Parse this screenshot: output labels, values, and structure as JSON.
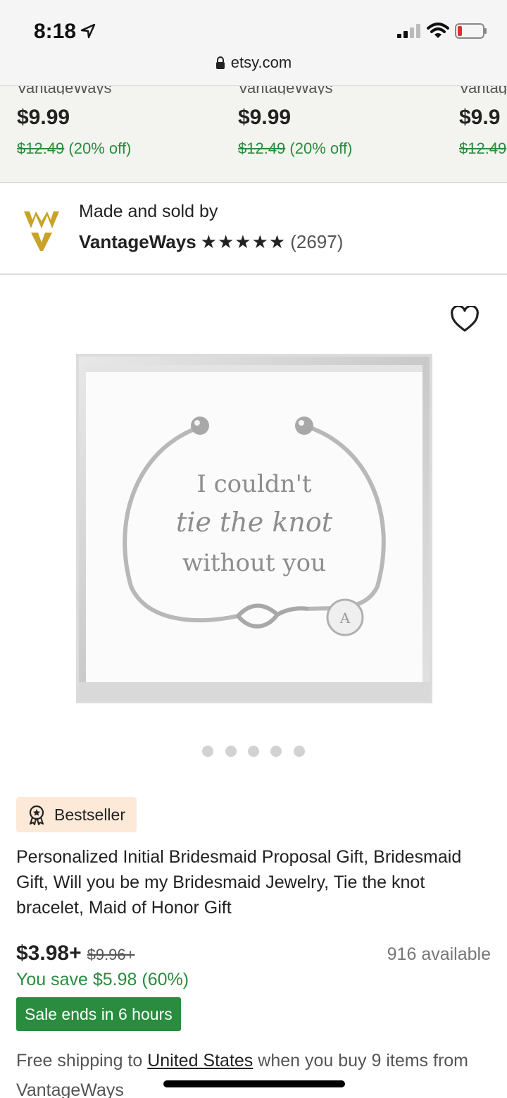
{
  "status_bar": {
    "time": "8:18"
  },
  "browser": {
    "url": "etsy.com"
  },
  "related_items": [
    {
      "shop": "VantageWays",
      "price": "$9.99",
      "original_price": "$12.49",
      "discount": "(20% off)"
    },
    {
      "shop": "VantageWays",
      "price": "$9.99",
      "original_price": "$12.49",
      "discount": "(20% off)"
    },
    {
      "shop": "Vantag",
      "price": "$9.9",
      "original_price": "$12.49",
      "discount": ""
    }
  ],
  "seller": {
    "made_by_label": "Made and sold by",
    "name": "VantageWays",
    "stars": "★★★★★",
    "review_count": "(2697)",
    "logo_letters": "WV"
  },
  "gallery": {
    "image_text_line1": "I couldn't",
    "image_text_line2": "tie the knot",
    "image_text_line3": "without you",
    "charm_letter": "A",
    "image_count": 5,
    "active_index": 0
  },
  "listing": {
    "badge": "Bestseller",
    "title": "Personalized Initial Bridesmaid Proposal Gift, Bridesmaid Gift, Will you be my Bridesmaid Jewelry, Tie the knot bracelet, Maid of Honor Gift",
    "price": "$3.98+",
    "original_price": "$9.96+",
    "available": "916 available",
    "savings": "You save $5.98 (60%)",
    "sale_notice": "Sale ends in 6 hours",
    "shipping_prefix": "Free shipping to ",
    "shipping_country": "United States",
    "shipping_suffix": " when you buy 9 items from VantageWays"
  },
  "colors": {
    "sale_green": "#2a8c3f",
    "badge_bg": "#fde9d8",
    "logo_gold": "#c9a227"
  }
}
